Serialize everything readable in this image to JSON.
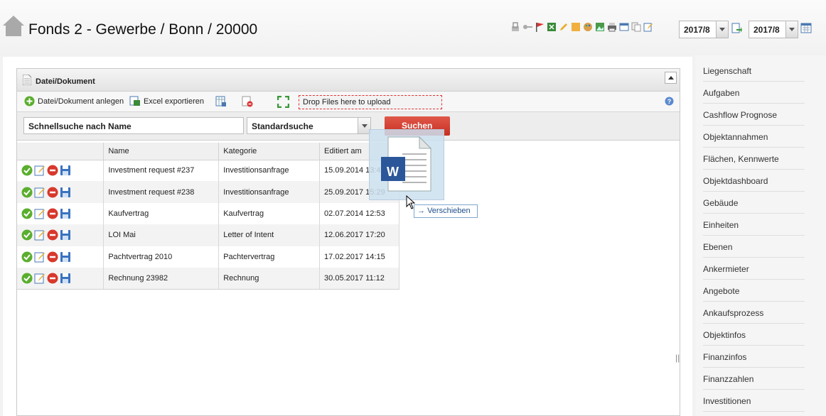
{
  "header": {
    "title": "Fonds 2 - Gewerbe / Bonn / 20000",
    "period_from": "2017/8",
    "period_to": "2017/8",
    "toolbar_icons": [
      "lock-icon",
      "key-icon",
      "flag-icon",
      "excel-icon",
      "pencil-icon",
      "note-icon",
      "palette-icon",
      "image-icon",
      "print-icon",
      "window-icon",
      "copy-icon",
      "edit-doc-icon"
    ]
  },
  "panel": {
    "title": "Datei/Dokument",
    "toolbar": {
      "add_label": "Datei/Dokument anlegen",
      "export_label": "Excel exportieren",
      "drop_label": "Drop Files here to upload"
    },
    "search": {
      "quick_search": "Schnellsuche nach Name",
      "search_type": "Standardsuche",
      "search_button": "Suchen"
    },
    "table": {
      "columns": [
        "",
        "Name",
        "Kategorie",
        "Editiert am"
      ],
      "rows": [
        {
          "name": "Investment request #237",
          "category": "Investitionsanfrage",
          "edited": "15.09.2014 13:47"
        },
        {
          "name": "Investment request #238",
          "category": "Investitionsanfrage",
          "edited": "25.09.2017 15:29"
        },
        {
          "name": "Kaufvertrag",
          "category": "Kaufvertrag",
          "edited": "02.07.2014 12:53"
        },
        {
          "name": "LOI Mai",
          "category": "Letter of Intent",
          "edited": "12.06.2017 17:20"
        },
        {
          "name": "Pachtvertrag 2010",
          "category": "Pachtervertrag",
          "edited": "17.02.2017 14:15"
        },
        {
          "name": "Rechnung 23982",
          "category": "Rechnung",
          "edited": "30.05.2017 11:12"
        }
      ]
    }
  },
  "drag": {
    "tooltip": "Verschieben",
    "file_icon": "word-document-icon",
    "badge": "W"
  },
  "sidebar": {
    "items": [
      "Liegenschaft",
      "Aufgaben",
      "Cashflow Prognose",
      "Objektannahmen",
      "Flächen, Kennwerte",
      "Objektdashboard",
      "Gebäude",
      "Einheiten",
      "Ebenen",
      "Ankermieter",
      "Angebote",
      "Ankaufsprozess",
      "Objektinfos",
      "Finanzinfos",
      "Finanzzahlen",
      "Investitionen"
    ]
  },
  "colors": {
    "accent_red": "#c9372c",
    "word_blue": "#2b579a",
    "tooltip_border": "#7ea6cf"
  }
}
